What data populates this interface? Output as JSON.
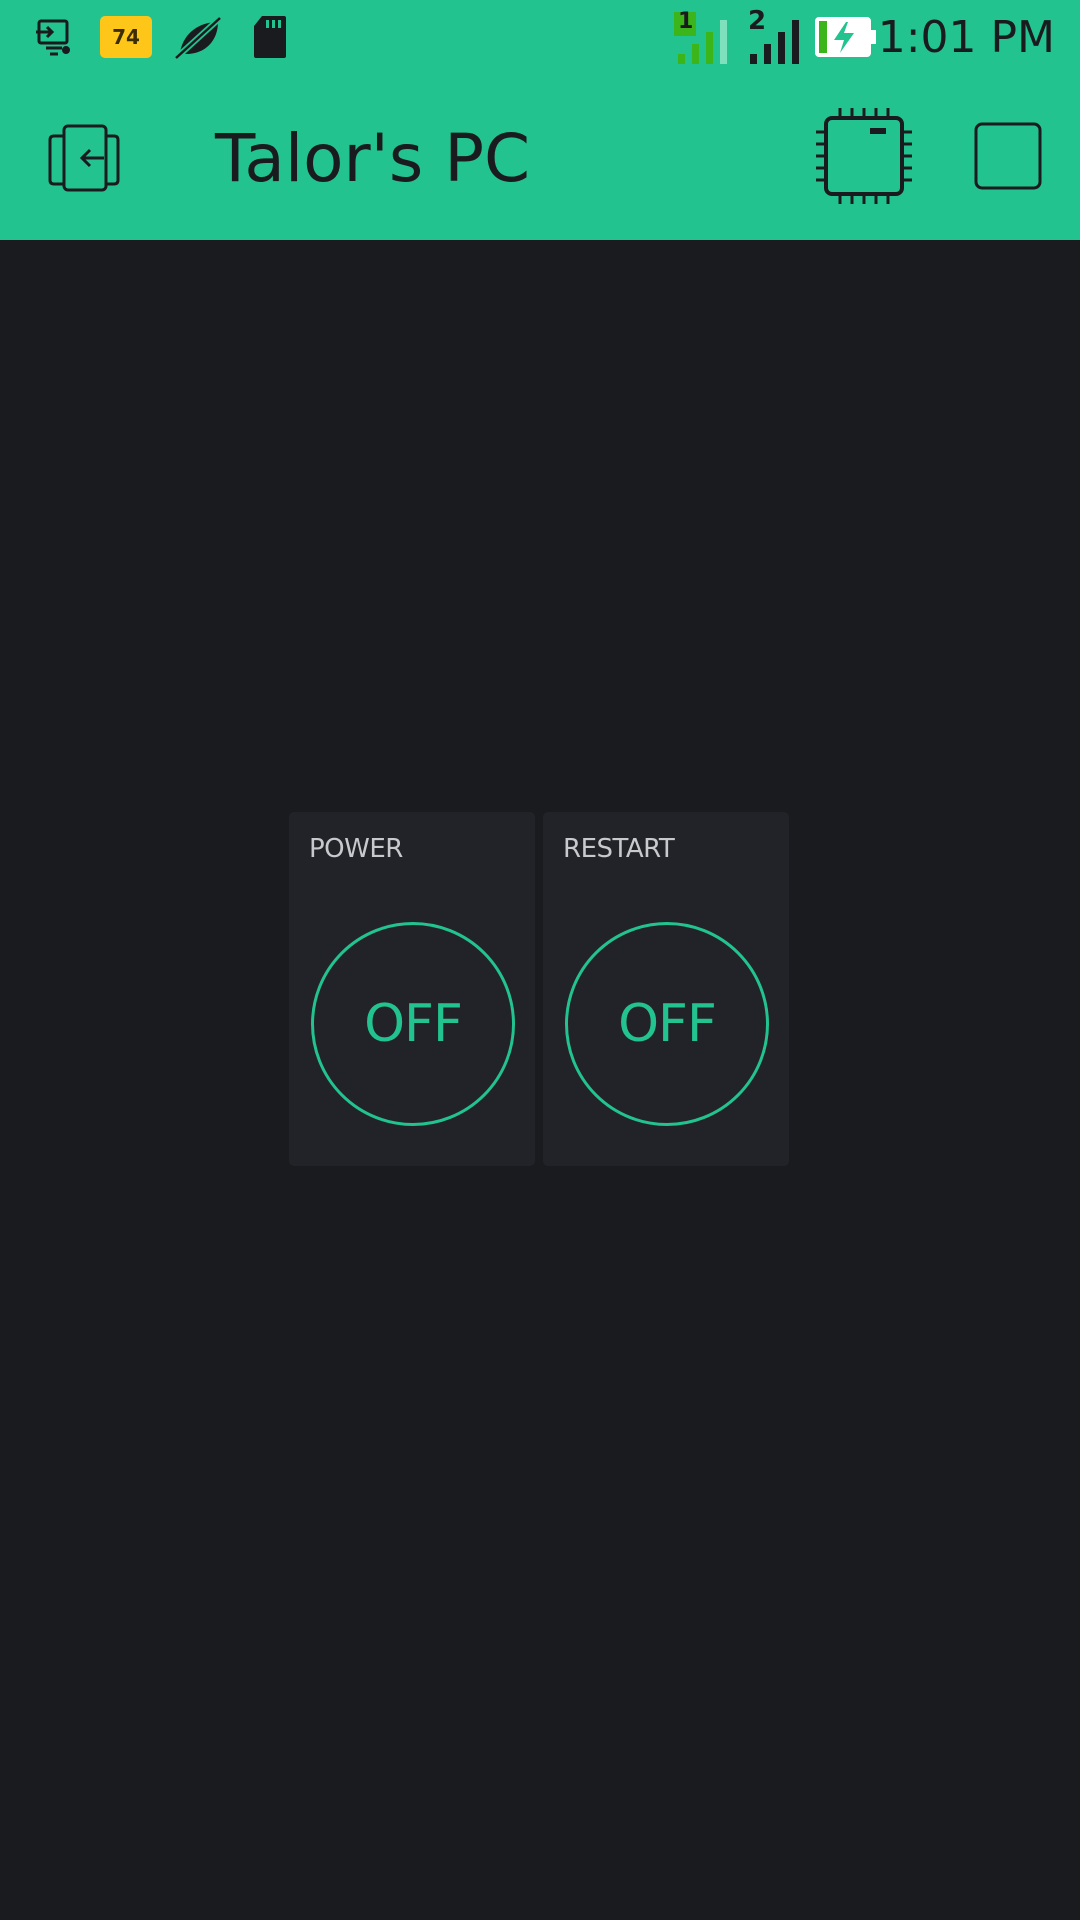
{
  "status_bar": {
    "time": "1:01 PM",
    "notification_badge": "74",
    "sim1_label": "1",
    "sim2_label": "2",
    "icons": [
      "screen-cast-icon",
      "notification-badge-icon",
      "muted-leaf-icon",
      "sd-card-icon",
      "signal-sim1-icon",
      "signal-sim2-icon",
      "battery-charging-icon"
    ]
  },
  "app_bar": {
    "title": "Talor's PC",
    "icons": [
      "back-exit-icon",
      "device-chip-icon",
      "stop-square-icon"
    ]
  },
  "widgets": [
    {
      "label": "POWER",
      "state": "OFF"
    },
    {
      "label": "RESTART",
      "state": "OFF"
    }
  ],
  "colors": {
    "accent": "#22c38e",
    "background": "#1a1b1f",
    "widget_background": "#222328",
    "dark_icon": "#1a1b1f",
    "badge": "#ffc61a"
  }
}
